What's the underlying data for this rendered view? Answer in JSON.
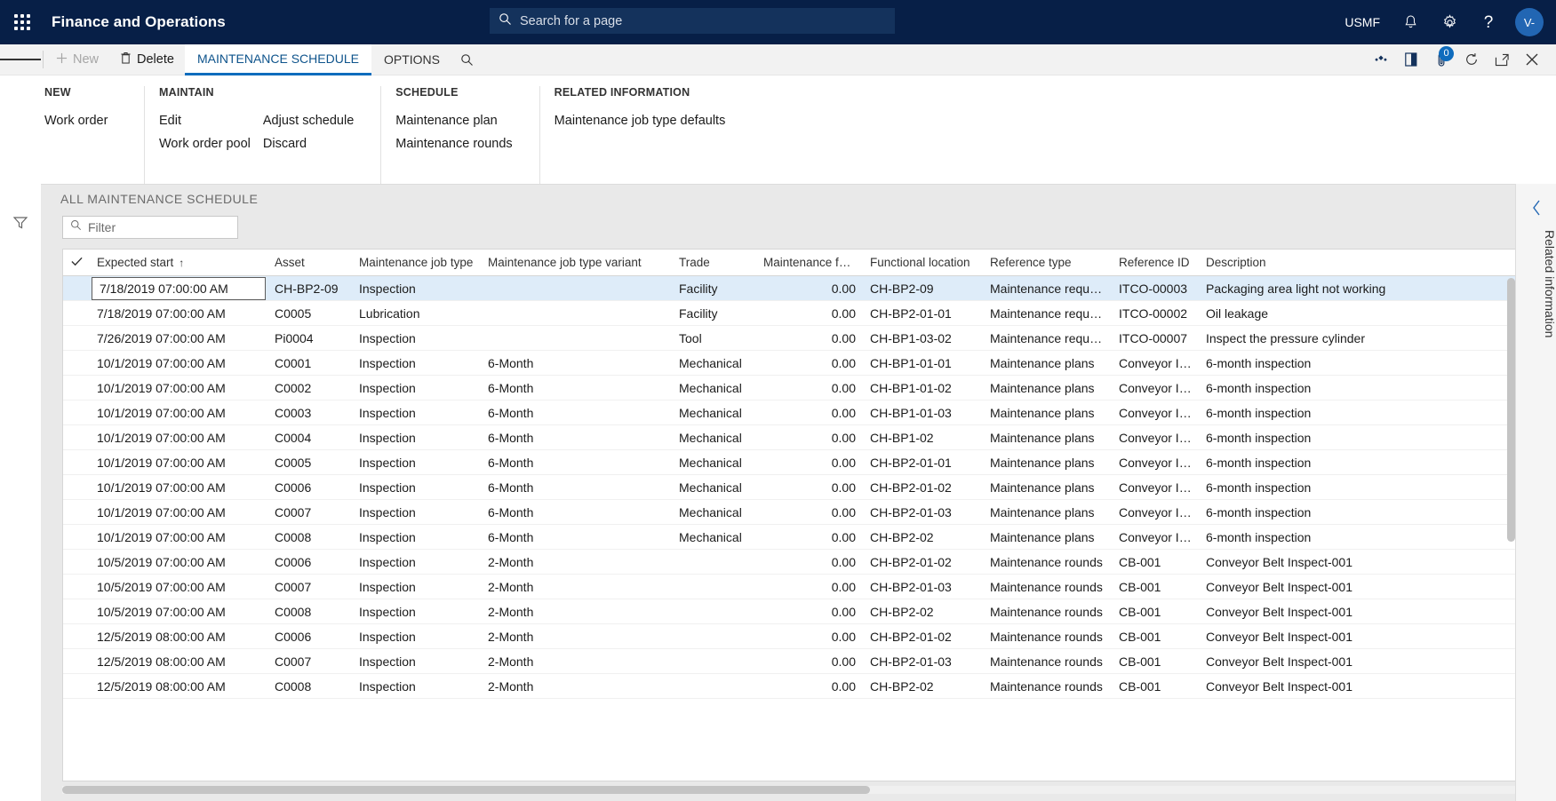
{
  "topbar": {
    "waffle_label": "app-launcher",
    "app_title": "Finance and Operations",
    "search_placeholder": "Search for a page",
    "company": "USMF",
    "avatar_initials": "V-",
    "icons": [
      "notifications-bell-icon",
      "settings-gear-icon",
      "help-question-icon"
    ]
  },
  "actionpane": {
    "new_label": "New",
    "delete_label": "Delete",
    "tabs": [
      {
        "label": "MAINTENANCE SCHEDULE",
        "active": true
      },
      {
        "label": "OPTIONS",
        "active": false
      }
    ],
    "search_icon": "search-icon",
    "right_icons": [
      "share-flow-icon",
      "open-in-office-icon",
      "attachments-icon",
      "refresh-icon",
      "popout-icon",
      "close-icon"
    ],
    "attachment_badge": "0"
  },
  "ribbon": {
    "groups": [
      {
        "title": "NEW",
        "columns": [
          {
            "items": [
              "Work order"
            ]
          }
        ]
      },
      {
        "title": "MAINTAIN",
        "columns": [
          {
            "items": [
              "Edit",
              "Work order pool"
            ]
          },
          {
            "items": [
              "Adjust schedule",
              "Discard"
            ]
          }
        ]
      },
      {
        "title": "SCHEDULE",
        "columns": [
          {
            "items": [
              "Maintenance plan",
              "Maintenance rounds"
            ]
          }
        ]
      },
      {
        "title": "RELATED INFORMATION",
        "columns": [
          {
            "items": [
              "Maintenance job type defaults"
            ]
          }
        ]
      }
    ]
  },
  "page": {
    "header": "ALL MAINTENANCE SCHEDULE",
    "filter_placeholder": "Filter"
  },
  "grid": {
    "sort_column": "Expected start",
    "sort_direction": "ascending",
    "columns": [
      {
        "key": "check",
        "label": "",
        "cls": "c-check"
      },
      {
        "key": "expected_start",
        "label": "Expected start",
        "cls": "c-start"
      },
      {
        "key": "asset",
        "label": "Asset",
        "cls": "c-asset"
      },
      {
        "key": "job_type",
        "label": "Maintenance job type",
        "cls": "c-jobtype"
      },
      {
        "key": "variant",
        "label": "Maintenance job type variant",
        "cls": "c-variant"
      },
      {
        "key": "trade",
        "label": "Trade",
        "cls": "c-trade"
      },
      {
        "key": "forecast",
        "label": "Maintenance forecast...",
        "cls": "c-forecast"
      },
      {
        "key": "functional_location",
        "label": "Functional location",
        "cls": "c-funcloc"
      },
      {
        "key": "reference_type",
        "label": "Reference type",
        "cls": "c-reftype"
      },
      {
        "key": "reference_id",
        "label": "Reference ID",
        "cls": "c-refid"
      },
      {
        "key": "description",
        "label": "Description",
        "cls": "c-desc"
      }
    ],
    "rows": [
      {
        "selected": true,
        "expected_start": "7/18/2019 07:00:00 AM",
        "asset": "CH-BP2-09",
        "job_type": "Inspection",
        "variant": "",
        "trade": "Facility",
        "forecast": "0.00",
        "functional_location": "CH-BP2-09",
        "reference_type": "Maintenance requests",
        "reference_id": "ITCO-00003",
        "description": "Packaging area light not working"
      },
      {
        "selected": false,
        "expected_start": "7/18/2019 07:00:00 AM",
        "asset": "C0005",
        "job_type": "Lubrication",
        "variant": "",
        "trade": "Facility",
        "forecast": "0.00",
        "functional_location": "CH-BP2-01-01",
        "reference_type": "Maintenance requests",
        "reference_id": "ITCO-00002",
        "description": "Oil leakage"
      },
      {
        "selected": false,
        "expected_start": "7/26/2019 07:00:00 AM",
        "asset": "Pi0004",
        "job_type": "Inspection",
        "variant": "",
        "trade": "Tool",
        "forecast": "0.00",
        "functional_location": "CH-BP1-03-02",
        "reference_type": "Maintenance requests",
        "reference_id": "ITCO-00007",
        "description": "Inspect the pressure cylinder"
      },
      {
        "selected": false,
        "expected_start": "10/1/2019 07:00:00 AM",
        "asset": "C0001",
        "job_type": "Inspection",
        "variant": "6-Month",
        "trade": "Mechanical",
        "forecast": "0.00",
        "functional_location": "CH-BP1-01-01",
        "reference_type": "Maintenance plans",
        "reference_id": "Conveyor Insp",
        "description": "6-month inspection"
      },
      {
        "selected": false,
        "expected_start": "10/1/2019 07:00:00 AM",
        "asset": "C0002",
        "job_type": "Inspection",
        "variant": "6-Month",
        "trade": "Mechanical",
        "forecast": "0.00",
        "functional_location": "CH-BP1-01-02",
        "reference_type": "Maintenance plans",
        "reference_id": "Conveyor Insp",
        "description": "6-month inspection"
      },
      {
        "selected": false,
        "expected_start": "10/1/2019 07:00:00 AM",
        "asset": "C0003",
        "job_type": "Inspection",
        "variant": "6-Month",
        "trade": "Mechanical",
        "forecast": "0.00",
        "functional_location": "CH-BP1-01-03",
        "reference_type": "Maintenance plans",
        "reference_id": "Conveyor Insp",
        "description": "6-month inspection"
      },
      {
        "selected": false,
        "expected_start": "10/1/2019 07:00:00 AM",
        "asset": "C0004",
        "job_type": "Inspection",
        "variant": "6-Month",
        "trade": "Mechanical",
        "forecast": "0.00",
        "functional_location": "CH-BP1-02",
        "reference_type": "Maintenance plans",
        "reference_id": "Conveyor Insp",
        "description": "6-month inspection"
      },
      {
        "selected": false,
        "expected_start": "10/1/2019 07:00:00 AM",
        "asset": "C0005",
        "job_type": "Inspection",
        "variant": "6-Month",
        "trade": "Mechanical",
        "forecast": "0.00",
        "functional_location": "CH-BP2-01-01",
        "reference_type": "Maintenance plans",
        "reference_id": "Conveyor Insp",
        "description": "6-month inspection"
      },
      {
        "selected": false,
        "expected_start": "10/1/2019 07:00:00 AM",
        "asset": "C0006",
        "job_type": "Inspection",
        "variant": "6-Month",
        "trade": "Mechanical",
        "forecast": "0.00",
        "functional_location": "CH-BP2-01-02",
        "reference_type": "Maintenance plans",
        "reference_id": "Conveyor Insp",
        "description": "6-month inspection"
      },
      {
        "selected": false,
        "expected_start": "10/1/2019 07:00:00 AM",
        "asset": "C0007",
        "job_type": "Inspection",
        "variant": "6-Month",
        "trade": "Mechanical",
        "forecast": "0.00",
        "functional_location": "CH-BP2-01-03",
        "reference_type": "Maintenance plans",
        "reference_id": "Conveyor Insp",
        "description": "6-month inspection"
      },
      {
        "selected": false,
        "expected_start": "10/1/2019 07:00:00 AM",
        "asset": "C0008",
        "job_type": "Inspection",
        "variant": "6-Month",
        "trade": "Mechanical",
        "forecast": "0.00",
        "functional_location": "CH-BP2-02",
        "reference_type": "Maintenance plans",
        "reference_id": "Conveyor Insp",
        "description": "6-month inspection"
      },
      {
        "selected": false,
        "expected_start": "10/5/2019 07:00:00 AM",
        "asset": "C0006",
        "job_type": "Inspection",
        "variant": "2-Month",
        "trade": "",
        "forecast": "0.00",
        "functional_location": "CH-BP2-01-02",
        "reference_type": "Maintenance rounds",
        "reference_id": "CB-001",
        "description": "Conveyor Belt Inspect-001"
      },
      {
        "selected": false,
        "expected_start": "10/5/2019 07:00:00 AM",
        "asset": "C0007",
        "job_type": "Inspection",
        "variant": "2-Month",
        "trade": "",
        "forecast": "0.00",
        "functional_location": "CH-BP2-01-03",
        "reference_type": "Maintenance rounds",
        "reference_id": "CB-001",
        "description": "Conveyor Belt Inspect-001"
      },
      {
        "selected": false,
        "expected_start": "10/5/2019 07:00:00 AM",
        "asset": "C0008",
        "job_type": "Inspection",
        "variant": "2-Month",
        "trade": "",
        "forecast": "0.00",
        "functional_location": "CH-BP2-02",
        "reference_type": "Maintenance rounds",
        "reference_id": "CB-001",
        "description": "Conveyor Belt Inspect-001"
      },
      {
        "selected": false,
        "expected_start": "12/5/2019 08:00:00 AM",
        "asset": "C0006",
        "job_type": "Inspection",
        "variant": "2-Month",
        "trade": "",
        "forecast": "0.00",
        "functional_location": "CH-BP2-01-02",
        "reference_type": "Maintenance rounds",
        "reference_id": "CB-001",
        "description": "Conveyor Belt Inspect-001"
      },
      {
        "selected": false,
        "expected_start": "12/5/2019 08:00:00 AM",
        "asset": "C0007",
        "job_type": "Inspection",
        "variant": "2-Month",
        "trade": "",
        "forecast": "0.00",
        "functional_location": "CH-BP2-01-03",
        "reference_type": "Maintenance rounds",
        "reference_id": "CB-001",
        "description": "Conveyor Belt Inspect-001"
      },
      {
        "selected": false,
        "expected_start": "12/5/2019 08:00:00 AM",
        "asset": "C0008",
        "job_type": "Inspection",
        "variant": "2-Month",
        "trade": "",
        "forecast": "0.00",
        "functional_location": "CH-BP2-02",
        "reference_type": "Maintenance rounds",
        "reference_id": "CB-001",
        "description": "Conveyor Belt Inspect-001"
      }
    ]
  },
  "rightrail": {
    "label": "Related information",
    "collapse_icon": "chevron-left-icon"
  },
  "colors": {
    "navy": "#071F47",
    "accent_blue": "#0f6cbd",
    "link_blue": "#2266b3",
    "selection": "#deecf9"
  }
}
